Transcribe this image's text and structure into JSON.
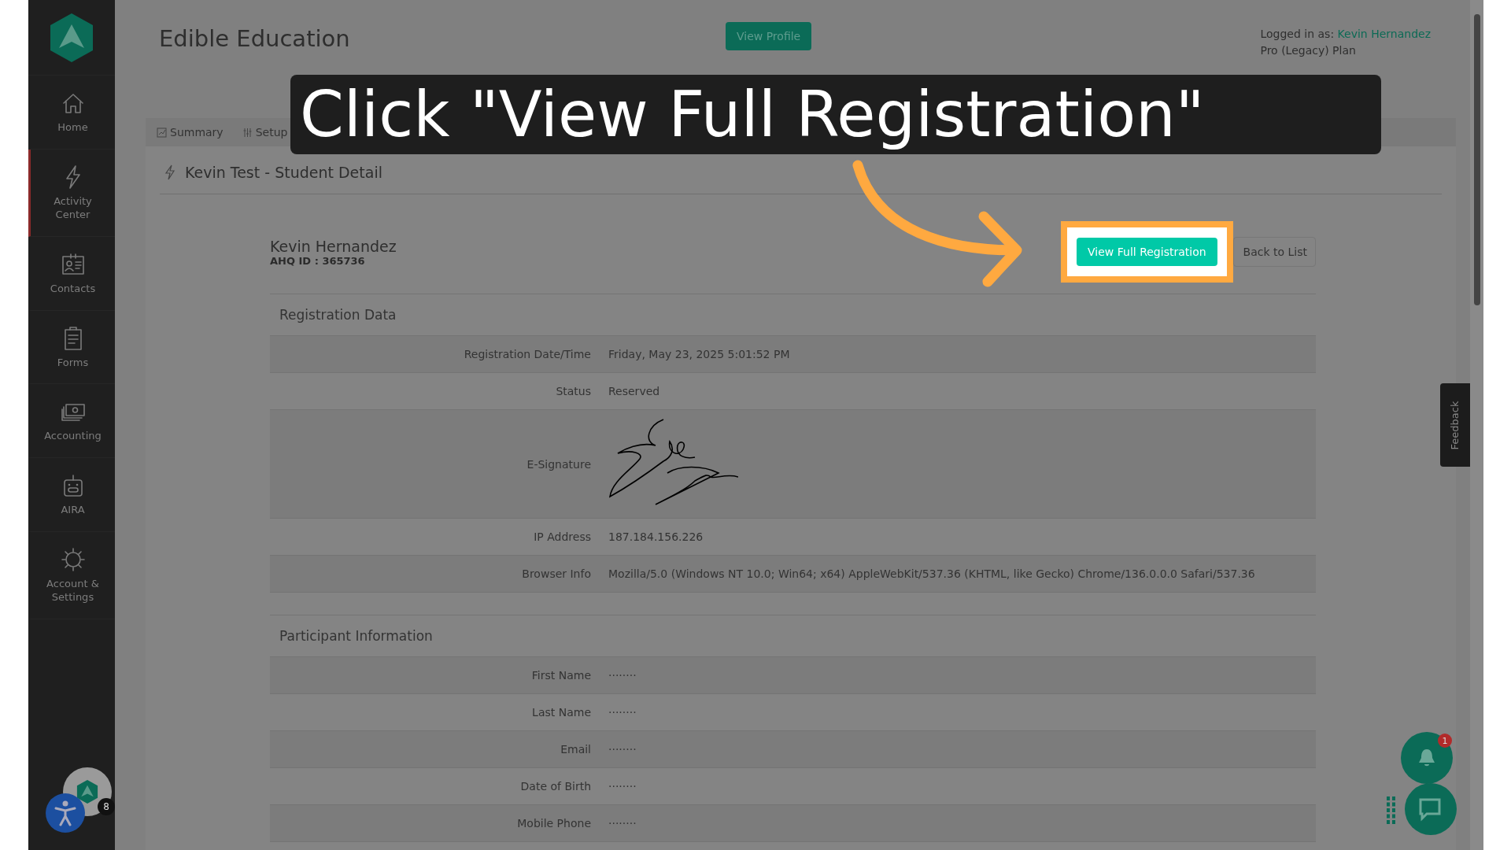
{
  "header": {
    "title": "Edible Education",
    "view_profile_button": "View Profile",
    "logged_in_label": "Logged in as:",
    "logged_in_user": "Kevin Hernandez",
    "plan": "Pro (Legacy) Plan"
  },
  "sidebar": {
    "items": [
      {
        "label": "Home",
        "selected": false
      },
      {
        "label": "Activity Center",
        "selected": true
      },
      {
        "label": "Contacts",
        "selected": false
      },
      {
        "label": "Forms",
        "selected": false
      },
      {
        "label": "Accounting",
        "selected": false
      },
      {
        "label": "AIRA",
        "selected": false
      },
      {
        "label": "Account & Settings",
        "selected": false
      }
    ],
    "accessibility_badge": "8"
  },
  "tabs": [
    {
      "label": "Summary"
    },
    {
      "label": "Setup"
    }
  ],
  "callout": {
    "text": "Click \"View Full Registration\""
  },
  "detail": {
    "title": "Kevin Test - Student Detail",
    "name": "Kevin Hernandez",
    "id_label": "AHQ ID : 365736",
    "view_button": "View Full Registration",
    "back_button": "Back to List"
  },
  "sections": [
    {
      "title": "Registration Data",
      "rows": [
        {
          "kind": "text",
          "label": "Registration Date/Time",
          "value": "Friday, May 23, 2025 5:01:52 PM"
        },
        {
          "kind": "text",
          "label": "Status",
          "value": "Reserved"
        },
        {
          "kind": "signature",
          "label": "E-Signature"
        },
        {
          "kind": "text",
          "label": "IP Address",
          "value": "187.184.156.226"
        },
        {
          "kind": "text",
          "label": "Browser Info",
          "value": "Mozilla/5.0 (Windows NT 10.0; Win64; x64) AppleWebKit/537.36 (KHTML, like Gecko) Chrome/136.0.0.0 Safari/537.36"
        }
      ]
    },
    {
      "title": "Participant Information",
      "rows": [
        {
          "kind": "text",
          "label": "First Name",
          "value": "········"
        },
        {
          "kind": "text",
          "label": "Last Name",
          "value": "········"
        },
        {
          "kind": "text",
          "label": "Email",
          "value": "········"
        },
        {
          "kind": "text",
          "label": "Date of Birth",
          "value": "········"
        },
        {
          "kind": "text",
          "label": "Mobile Phone",
          "value": "········"
        }
      ]
    }
  ],
  "feedback": "Feedback",
  "notification_badge": "1"
}
